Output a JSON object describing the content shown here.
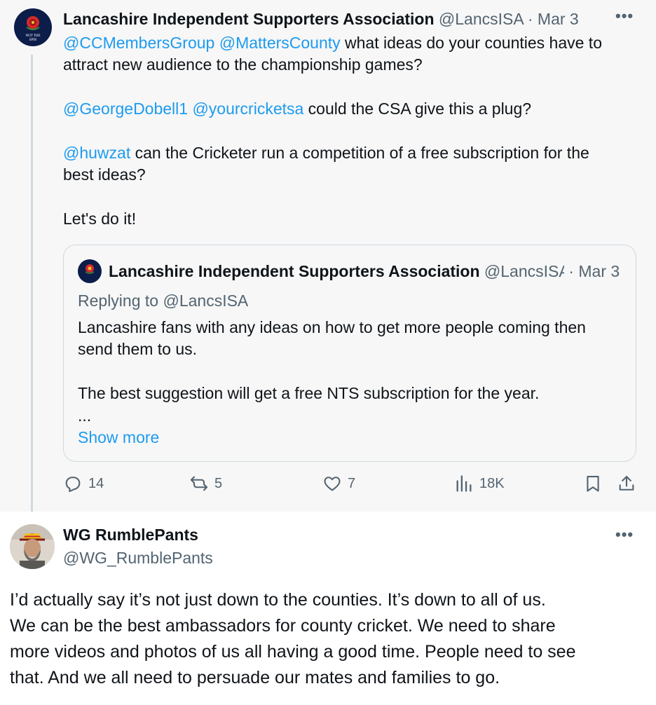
{
  "tweet": {
    "author_name": "Lancashire Independent Supporters Association",
    "author_handle": "@LancsISA",
    "separator": " · ",
    "date": "Mar 3",
    "avatar_text": "NOT THE SPIN",
    "line1_mentions": [
      "@CCMembersGroup",
      "@MattersCounty"
    ],
    "line1_text": " what ideas do your counties have to",
    "line2_text": "attract new audience to the championship games?",
    "line3_mentions": [
      "@GeorgeDobell1",
      "@yourcricketsa"
    ],
    "line3_text": " could the CSA give this a plug?",
    "line4_mention": "@huwzat",
    "line4_text": " can the Cricketer run a competition of a free subscription for the",
    "line5_text": "best ideas?",
    "line6_text": "Let's do it!",
    "quote": {
      "author_name": "Lancashire Independent Supporters Association",
      "author_handle": "@LancsISA",
      "separator": " · ",
      "date": "Mar 3",
      "replying_label": "Replying to ",
      "replying_handle": "@LancsISA",
      "line1": "Lancashire fans with any ideas on how to get more people coming then",
      "line2": "send them to us.",
      "line3": "The best suggestion will get a free NTS subscription for the year.",
      "ellipsis": "...",
      "show_more": "Show more"
    },
    "stats": {
      "replies": "14",
      "reposts": "5",
      "likes": "7",
      "views": "18K"
    }
  },
  "reply": {
    "author_name": "WG RumblePants",
    "author_handle": "@WG_RumblePants",
    "lines": [
      "I’d actually say it’s not just down to the counties. It’s down to all of us.",
      "We can be the best ambassadors for county cricket. We need to share",
      "more videos and photos of us all having a good time. People need to see",
      "that. And we all need to persuade our mates and families to go."
    ]
  },
  "colors": {
    "link": "#1d9bf0",
    "muted": "#536471",
    "text": "#0f1419",
    "thread_bg": "#f7f7f7",
    "border": "#cfd9de"
  },
  "icons": [
    "more-icon",
    "reply-icon",
    "repost-icon",
    "like-icon",
    "views-icon",
    "bookmark-icon",
    "share-icon"
  ]
}
